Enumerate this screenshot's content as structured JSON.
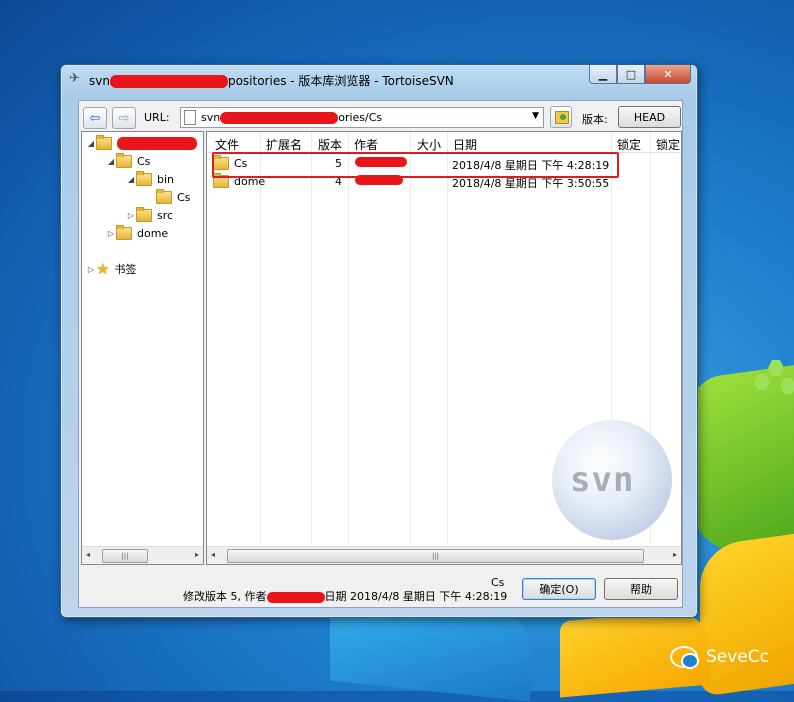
{
  "window": {
    "title_prefix": "svn",
    "title_suffix": "positories - 版本库浏览器 - TortoiseSVN",
    "min_glyph": "▁",
    "max_glyph": "□",
    "close_glyph": "✕"
  },
  "toolbar": {
    "back_glyph": "⇦",
    "forward_glyph": "⇨",
    "url_label": "URL:",
    "url_prefix": "svn",
    "url_suffix": "ories/Cs",
    "revision_label": "版本:",
    "head_button": "HEAD"
  },
  "tree": {
    "items": [
      {
        "label": "",
        "expanded": "◢"
      },
      {
        "label": "Cs",
        "expanded": "◢"
      },
      {
        "label": "bin",
        "expanded": "◢"
      },
      {
        "label": "Cs",
        "expanded": ""
      },
      {
        "label": "src",
        "expanded": "▷"
      },
      {
        "label": "dome",
        "expanded": "▷"
      }
    ],
    "bookmarks_label": "书签",
    "bookmarks_toggle": "▷"
  },
  "list": {
    "columns": [
      "文件",
      "扩展名",
      "版本",
      "作者",
      "大小",
      "日期",
      "锁定",
      "锁定"
    ],
    "rows": [
      {
        "name": "Cs",
        "revision": "5",
        "date": "2018/4/8 星期日 下午 4:28:19"
      },
      {
        "name": "dome",
        "revision": "4",
        "date": "2018/4/8 星期日 下午 3:50:55"
      }
    ],
    "logo_text": "svn"
  },
  "status": {
    "selected": "Cs",
    "revision_text": "修改版本 5, 作者",
    "date_text": "日期 2018/4/8 星期日 下午 4:28:19"
  },
  "buttons": {
    "ok": "确定(O)",
    "help": "帮助"
  },
  "watermark": "SeveCc",
  "scroll": {
    "left": "◂",
    "right": "▸",
    "grip": "|||"
  }
}
